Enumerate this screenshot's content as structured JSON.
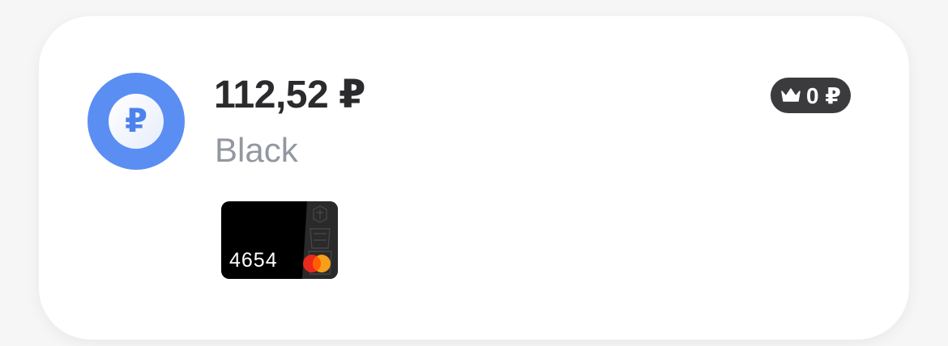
{
  "account": {
    "balance": "112,52 ₽",
    "name": "Black",
    "currency_symbol": "₽",
    "icon": "ruble-icon"
  },
  "cashback": {
    "amount": "0 ₽",
    "icon": "crown-icon"
  },
  "card": {
    "last_digits": "4654",
    "network_icon": "mastercard-icon"
  },
  "colors": {
    "accent": "#5b8ef3",
    "badge_bg": "#3b3b3d",
    "card_bg": "#000000",
    "secondary_text": "#9297a0"
  }
}
